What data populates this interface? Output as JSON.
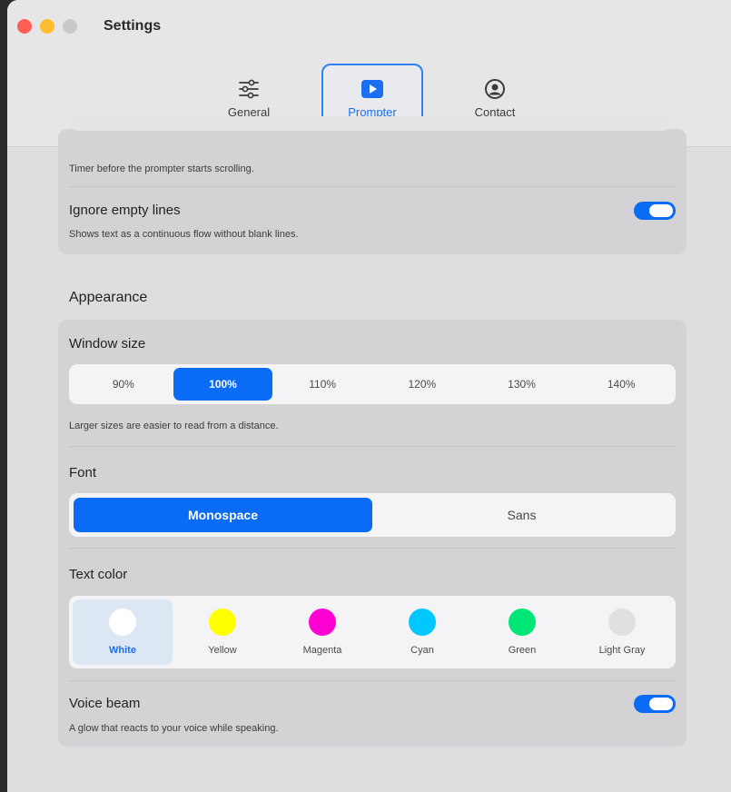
{
  "window": {
    "title": "Settings"
  },
  "toolbar": {
    "tabs": [
      {
        "label": "General",
        "icon": "sliders-icon"
      },
      {
        "label": "Prompter",
        "icon": "play-icon",
        "selected": true
      },
      {
        "label": "Contact",
        "icon": "person-circle-icon"
      }
    ]
  },
  "timer": {
    "description": "Timer before the prompter starts scrolling."
  },
  "ignore_empty_lines": {
    "label": "Ignore empty lines",
    "description": "Shows text as a continuous flow without blank lines.",
    "enabled": true
  },
  "appearance": {
    "heading": "Appearance",
    "window_size": {
      "label": "Window size",
      "options": [
        "90%",
        "100%",
        "110%",
        "120%",
        "130%",
        "140%"
      ],
      "selected": "100%",
      "description": "Larger sizes are easier to read from a distance."
    },
    "font": {
      "label": "Font",
      "options": [
        "Monospace",
        "Sans"
      ],
      "selected": "Monospace"
    },
    "text_color": {
      "label": "Text color",
      "options": [
        {
          "name": "White",
          "color": "#ffffff"
        },
        {
          "name": "Yellow",
          "color": "#ffff00"
        },
        {
          "name": "Magenta",
          "color": "#ff00d4"
        },
        {
          "name": "Cyan",
          "color": "#00c8ff"
        },
        {
          "name": "Green",
          "color": "#00e676"
        },
        {
          "name": "Light Gray",
          "color": "#e0e0e0"
        }
      ],
      "selected": "White"
    },
    "voice_beam": {
      "label": "Voice beam",
      "description": "A glow that reacts to your voice while speaking.",
      "enabled": true
    }
  },
  "colors": {
    "accent": "#0a6cf5",
    "toggle_on": "#0a6cf5"
  }
}
